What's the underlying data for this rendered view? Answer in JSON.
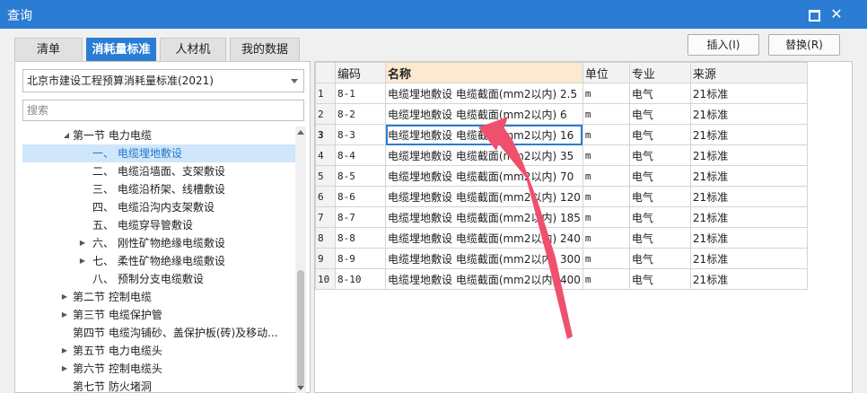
{
  "window": {
    "title": "查询"
  },
  "tabs": [
    {
      "label": "清单"
    },
    {
      "label": "消耗量标准"
    },
    {
      "label": "人材机"
    },
    {
      "label": "我的数据"
    }
  ],
  "actions": {
    "insert_label": "插入(I)",
    "replace_label": "替换(R)"
  },
  "left": {
    "standard_select": "北京市建设工程预算消耗量标准(2021)",
    "search_placeholder": "搜索",
    "tree": [
      {
        "label": "第一节 电力电缆",
        "expander": "expanded"
      },
      {
        "label": "一、 电缆埋地敷设",
        "selected": true
      },
      {
        "label": "二、 电缆沿墙面、支架敷设"
      },
      {
        "label": "三、 电缆沿桥架、线槽敷设"
      },
      {
        "label": "四、 电缆沿沟内支架敷设"
      },
      {
        "label": "五、 电缆穿导管敷设"
      },
      {
        "label": "六、 刚性矿物绝缘电缆敷设",
        "expander": "collapsed"
      },
      {
        "label": "七、 柔性矿物绝缘电缆敷设",
        "expander": "collapsed"
      },
      {
        "label": "八、 预制分支电缆敷设"
      },
      {
        "label": "第二节 控制电缆",
        "expander": "collapsed"
      },
      {
        "label": "第三节 电缆保护管",
        "expander": "collapsed"
      },
      {
        "label": "第四节 电缆沟铺砂、盖保护板(砖)及移动..."
      },
      {
        "label": "第五节 电力电缆头",
        "expander": "collapsed"
      },
      {
        "label": "第六节 控制电缆头",
        "expander": "collapsed"
      },
      {
        "label": "第七节 防火堵洞"
      }
    ]
  },
  "grid": {
    "columns": [
      "编码",
      "名称",
      "单位",
      "专业",
      "来源"
    ],
    "rows": [
      {
        "idx": "1",
        "code": "8-1",
        "name": "电缆埋地敷设 电缆截面(mm2以内) 2.5",
        "unit": "m",
        "major": "电气",
        "source": "21标准"
      },
      {
        "idx": "2",
        "code": "8-2",
        "name": "电缆埋地敷设 电缆截面(mm2以内) 6",
        "unit": "m",
        "major": "电气",
        "source": "21标准"
      },
      {
        "idx": "3",
        "code": "8-3",
        "name": "电缆埋地敷设 电缆截面(mm2以内) 16",
        "unit": "m",
        "major": "电气",
        "source": "21标准"
      },
      {
        "idx": "4",
        "code": "8-4",
        "name": "电缆埋地敷设 电缆截面(mm2以内) 35",
        "unit": "m",
        "major": "电气",
        "source": "21标准"
      },
      {
        "idx": "5",
        "code": "8-5",
        "name": "电缆埋地敷设 电缆截面(mm2以内) 70",
        "unit": "m",
        "major": "电气",
        "source": "21标准"
      },
      {
        "idx": "6",
        "code": "8-6",
        "name": "电缆埋地敷设 电缆截面(mm2以内) 120",
        "unit": "m",
        "major": "电气",
        "source": "21标准"
      },
      {
        "idx": "7",
        "code": "8-7",
        "name": "电缆埋地敷设 电缆截面(mm2以内) 185",
        "unit": "m",
        "major": "电气",
        "source": "21标准"
      },
      {
        "idx": "8",
        "code": "8-8",
        "name": "电缆埋地敷设 电缆截面(mm2以内) 240",
        "unit": "m",
        "major": "电气",
        "source": "21标准"
      },
      {
        "idx": "9",
        "code": "8-9",
        "name": "电缆埋地敷设 电缆截面(mm2以内) 300",
        "unit": "m",
        "major": "电气",
        "source": "21标准"
      },
      {
        "idx": "10",
        "code": "8-10",
        "name": "电缆埋地敷设 电缆截面(mm2以内) 400",
        "unit": "m",
        "major": "电气",
        "source": "21标准"
      }
    ]
  },
  "colors": {
    "accent": "#2b7cd3",
    "annotation_arrow": "#f0506e"
  }
}
